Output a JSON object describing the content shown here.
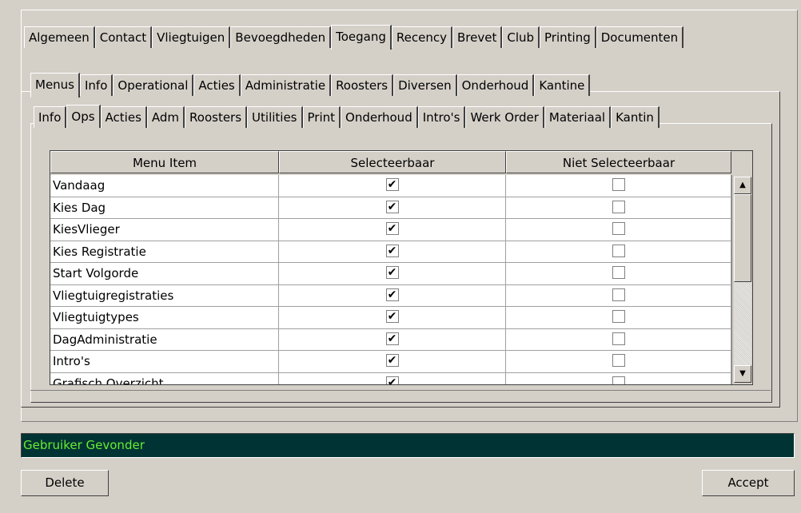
{
  "tabs_top": [
    "Algemeen",
    "Contact",
    "Vliegtuigen",
    "Bevoegdheden",
    "Toegang",
    "Recency",
    "Brevet",
    "Club",
    "Printing",
    "Documenten"
  ],
  "tabs_top_active": "Toegang",
  "tabs_mid": [
    "Menus",
    "Info",
    "Operational",
    "Acties",
    "Administratie",
    "Roosters",
    "Diversen",
    "Onderhoud",
    "Kantine"
  ],
  "tabs_mid_active": "Menus",
  "tabs_inner": [
    "Info",
    "Ops",
    "Acties",
    "Adm",
    "Roosters",
    "Utilities",
    "Print",
    "Onderhoud",
    "Intro's",
    "Werk Order",
    "Materiaal",
    "Kantin"
  ],
  "tabs_inner_active": "Ops",
  "grid": {
    "headers": [
      "Menu Item",
      "Selecteerbaar",
      "Niet Selecteerbaar"
    ],
    "rows": [
      {
        "item": "Vandaag",
        "sel": true,
        "niet": false
      },
      {
        "item": "Kies Dag",
        "sel": true,
        "niet": false
      },
      {
        "item": "KiesVlieger",
        "sel": true,
        "niet": false
      },
      {
        "item": "Kies Registratie",
        "sel": true,
        "niet": false
      },
      {
        "item": "Start Volgorde",
        "sel": true,
        "niet": false
      },
      {
        "item": "Vliegtuigregistraties",
        "sel": true,
        "niet": false
      },
      {
        "item": "Vliegtuigtypes",
        "sel": true,
        "niet": false
      },
      {
        "item": "DagAdministratie",
        "sel": true,
        "niet": false
      },
      {
        "item": "Intro's",
        "sel": true,
        "niet": false
      },
      {
        "item": "Grafisch Overzicht",
        "sel": true,
        "niet": false
      }
    ]
  },
  "status": {
    "text": "Gebruiker Gevonder",
    "bg": "#003333",
    "fg": "#66ee33"
  },
  "buttons": {
    "delete": "Delete",
    "accept": "Accept"
  }
}
